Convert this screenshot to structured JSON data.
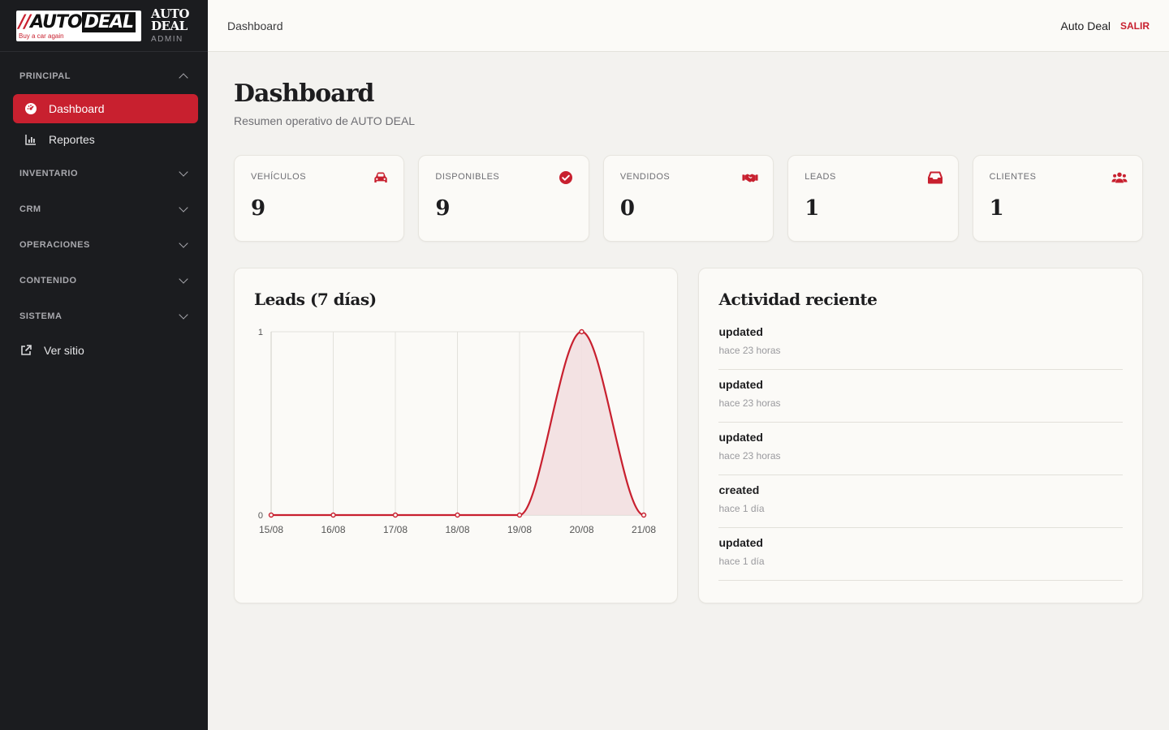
{
  "brand": {
    "logo_prefix": "//",
    "logo_auto": "AUTO",
    "logo_deal": "DEAL",
    "logo_tagline": "Buy a car again",
    "title_line1": "AUTO",
    "title_line2": "DEAL",
    "subtitle": "ADMIN"
  },
  "sidebar": {
    "sections": [
      {
        "label": "PRINCIPAL",
        "expanded": true
      },
      {
        "label": "INVENTARIO",
        "expanded": false
      },
      {
        "label": "CRM",
        "expanded": false
      },
      {
        "label": "OPERACIONES",
        "expanded": false
      },
      {
        "label": "CONTENIDO",
        "expanded": false
      },
      {
        "label": "SISTEMA",
        "expanded": false
      }
    ],
    "principal_items": [
      {
        "label": "Dashboard",
        "icon": "dashboard-gauge-icon",
        "active": true
      },
      {
        "label": "Reportes",
        "icon": "bar-chart-icon",
        "active": false
      }
    ],
    "external": {
      "label": "Ver sitio",
      "icon": "external-link-icon"
    }
  },
  "topbar": {
    "title": "Dashboard",
    "user": "Auto Deal",
    "logout": "SALIR"
  },
  "page": {
    "title": "Dashboard",
    "subtitle": "Resumen operativo de AUTO DEAL"
  },
  "stats": [
    {
      "label": "VEHÍCULOS",
      "value": "9",
      "icon": "car-icon"
    },
    {
      "label": "DISPONIBLES",
      "value": "9",
      "icon": "check-circle-icon"
    },
    {
      "label": "VENDIDOS",
      "value": "0",
      "icon": "handshake-icon"
    },
    {
      "label": "LEADS",
      "value": "1",
      "icon": "inbox-icon"
    },
    {
      "label": "CLIENTES",
      "value": "1",
      "icon": "users-icon"
    }
  ],
  "leads_panel": {
    "title": "Leads (7 días)"
  },
  "chart_data": {
    "type": "area",
    "title": "Leads (7 días)",
    "categories": [
      "15/08",
      "16/08",
      "17/08",
      "18/08",
      "19/08",
      "20/08",
      "21/08"
    ],
    "values": [
      0,
      0,
      0,
      0,
      0,
      1,
      0
    ],
    "ylim": [
      0,
      1
    ],
    "yticks": [
      "0",
      "1"
    ],
    "grid": true,
    "line_color": "#c8202f",
    "fill_color": "#f2dfe0"
  },
  "activity": {
    "title": "Actividad reciente",
    "items": [
      {
        "action": "updated",
        "time": "hace 23 horas"
      },
      {
        "action": "updated",
        "time": "hace 23 horas"
      },
      {
        "action": "updated",
        "time": "hace 23 horas"
      },
      {
        "action": "created",
        "time": "hace 1 día"
      },
      {
        "action": "updated",
        "time": "hace 1 día"
      }
    ]
  },
  "colors": {
    "accent": "#c8202f",
    "sidebar_bg": "#1b1c1f",
    "page_bg": "#f3f2ef",
    "card_bg": "#fbfaf7"
  }
}
